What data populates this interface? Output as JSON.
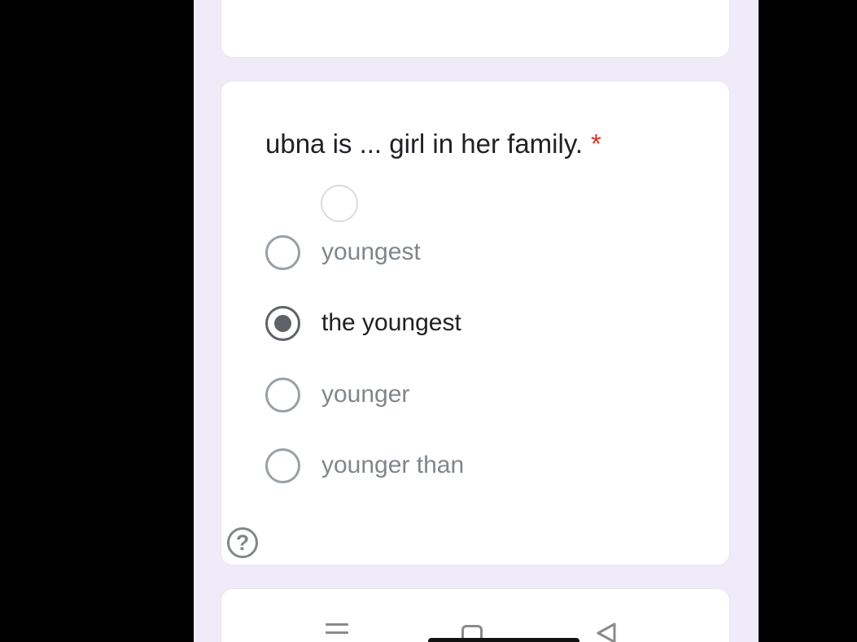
{
  "question": {
    "text": "ubna is ... girl in her family.",
    "required_marker": "*"
  },
  "options": [
    {
      "label": "youngest",
      "selected": false
    },
    {
      "label": "the youngest",
      "selected": true
    },
    {
      "label": "younger",
      "selected": false
    },
    {
      "label": "younger than",
      "selected": false
    }
  ],
  "help": {
    "symbol": "?"
  },
  "navbar": {
    "icons": [
      "recents-icon",
      "home-icon",
      "back-icon"
    ]
  },
  "colors": {
    "background": "#f0ebf8",
    "card": "#ffffff",
    "required": "#d93025",
    "radio_selected": "#5f6368"
  }
}
